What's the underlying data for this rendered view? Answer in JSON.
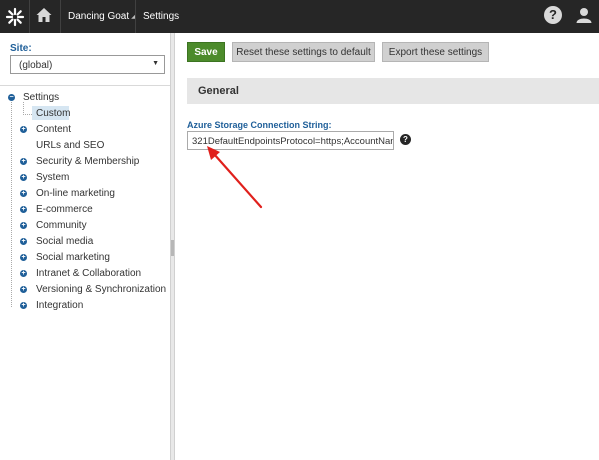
{
  "header": {
    "site_name": "Dancing Goat",
    "app_name": "Settings",
    "help_label": "?"
  },
  "sidebar": {
    "site_label": "Site:",
    "site_value": "(global)",
    "tree": {
      "root": "Settings",
      "selected": "Custom",
      "items": [
        "Content",
        "URLs and SEO",
        "Security & Membership",
        "System",
        "On-line marketing",
        "E-commerce",
        "Community",
        "Social media",
        "Social marketing",
        "Intranet & Collaboration",
        "Versioning & Synchronization",
        "Integration"
      ]
    }
  },
  "toolbar": {
    "save_label": "Save",
    "reset_label": "Reset these settings to default",
    "export_label": "Export these settings"
  },
  "section": {
    "title": "General",
    "field_label": "Azure Storage Connection String:",
    "field_value": "321DefaultEndpointsProtocol=https;AccountNan",
    "help_label": "?"
  },
  "colors": {
    "topbar": "#262626",
    "accent_blue": "#1f5f99",
    "save_green": "#4c8b2b",
    "annotation_red": "#e0201c"
  }
}
